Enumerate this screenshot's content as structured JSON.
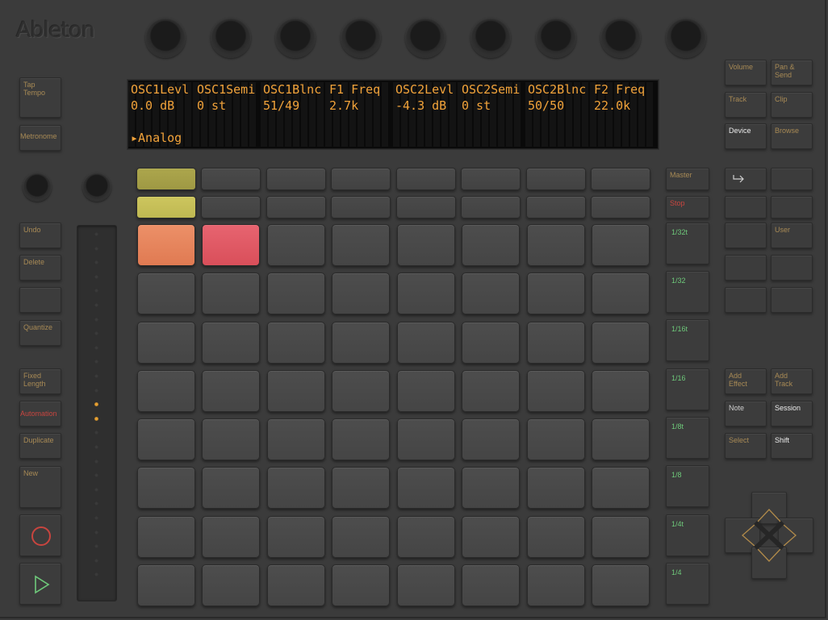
{
  "brand": {
    "logo": "Ableton"
  },
  "colors": {
    "display_text": "#f2a33a",
    "label_amber": "#a88a55",
    "label_red": "#c8453f",
    "label_green": "#6ec97a",
    "pad_yellow_dim": "#a9a34a",
    "pad_yellow": "#c8c25a",
    "pad_orange": "#e8835a",
    "pad_red": "#e05660"
  },
  "display": {
    "row1": [
      "OSC1Levl",
      "OSC1Semi",
      "OSC1Blnc",
      "F1 Freq",
      "OSC2Levl",
      "OSC2Semi",
      "OSC2Blnc",
      "F2 Freq"
    ],
    "row2": [
      "0.0 dB",
      "0 st",
      "51/49",
      "2.7k",
      "-4.3 dB",
      "0 st",
      "50/50",
      "22.0k"
    ],
    "row4": "▸Analog"
  },
  "left_buttons": {
    "tap_tempo": "Tap\nTempo",
    "metronome": "Metronome",
    "undo": "Undo",
    "delete": "Delete",
    "quantize": "Quantize",
    "fixed_length": "Fixed\nLength",
    "automation": "Automation",
    "duplicate": "Duplicate",
    "new": "New"
  },
  "transport": {
    "record_icon": "record-icon",
    "play_icon": "play-icon"
  },
  "scene_column": {
    "master": "Master",
    "stop": "Stop",
    "scenes": [
      "1/32t",
      "1/32",
      "1/16t",
      "1/16",
      "1/8t",
      "1/8",
      "1/4t",
      "1/4"
    ]
  },
  "right_buttons": {
    "volume": "Volume",
    "pan_send": "Pan &\nSend",
    "track": "Track",
    "clip": "Clip",
    "device": "Device",
    "browse": "Browse",
    "user": "User",
    "add_effect": "Add\nEffect",
    "add_track": "Add\nTrack",
    "note": "Note",
    "session": "Session",
    "select": "Select",
    "shift": "Shift",
    "arrow_icon": "return-arrow-icon"
  },
  "touch_strip": {
    "active_leds": [
      12,
      13
    ]
  }
}
